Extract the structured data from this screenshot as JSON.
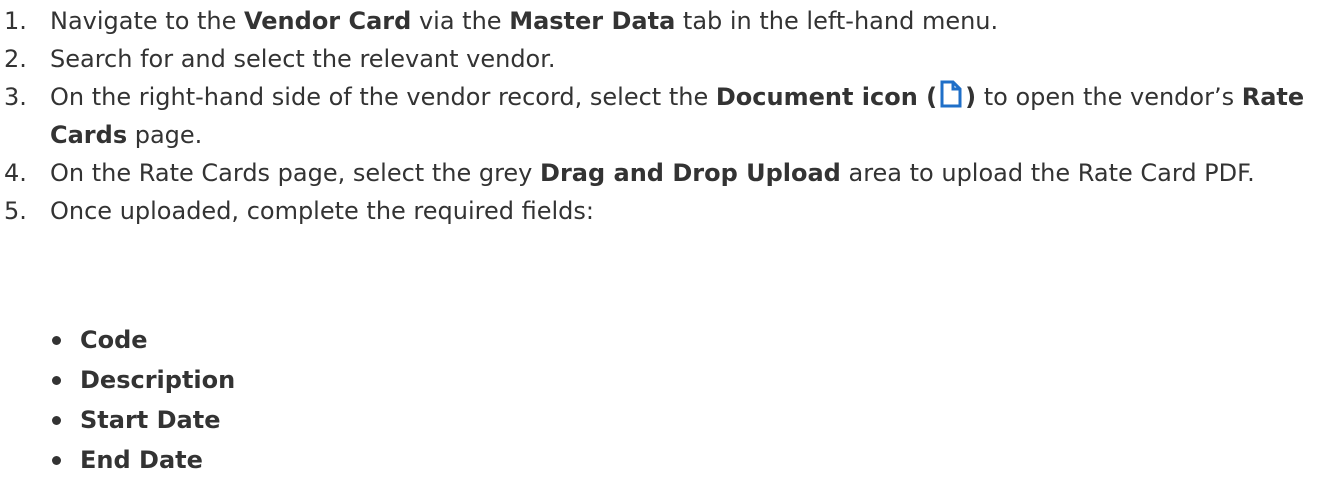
{
  "steps": [
    {
      "num": "1.",
      "parts": [
        {
          "t": "Navigate to the "
        },
        {
          "b": "Vendor Card"
        },
        {
          "t": " via the "
        },
        {
          "b": "Master Data"
        },
        {
          "t": " tab in the left-hand menu."
        }
      ]
    },
    {
      "num": "2.",
      "parts": [
        {
          "t": "Search for and select the relevant vendor."
        }
      ]
    },
    {
      "num": "3.",
      "parts": [
        {
          "t": "On the right-hand side of the vendor record, select the "
        },
        {
          "b": "Document icon ("
        },
        {
          "icon": "document-icon"
        },
        {
          "b": ")"
        },
        {
          "t": " to open the vendor’s "
        },
        {
          "b": "Rate Cards"
        },
        {
          "t": " page."
        }
      ]
    },
    {
      "num": "4.",
      "parts": [
        {
          "t": "On the Rate Cards page, select the grey "
        },
        {
          "b": "Drag and Drop Upload"
        },
        {
          "t": " area to upload the Rate Card PDF."
        }
      ]
    },
    {
      "num": "5.",
      "parts": [
        {
          "t": "Once uploaded, complete the required fields:"
        }
      ]
    }
  ],
  "fields": [
    "Code",
    "Description",
    "Start Date",
    "End Date"
  ],
  "colors": {
    "text": "#333333",
    "icon": "#1f6fc8"
  }
}
